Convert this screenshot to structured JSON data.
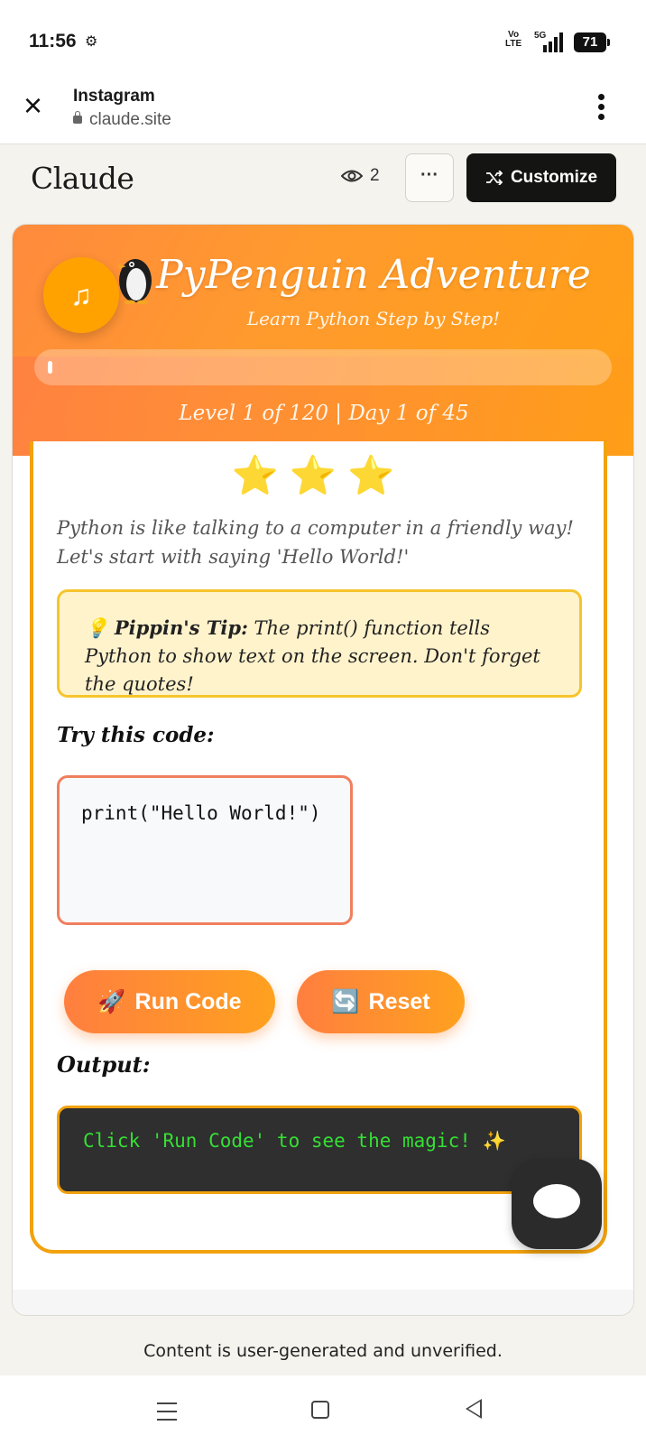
{
  "status_bar": {
    "time": "11:56",
    "network_label": "Vo LTE",
    "network_type": "5G",
    "battery": "71"
  },
  "browser": {
    "app_title": "Instagram",
    "url": "claude.site"
  },
  "claude_header": {
    "logo": "Claude",
    "view_count": "2",
    "more_label": "···",
    "customize_label": "Customize"
  },
  "hero": {
    "music_icon": "♫",
    "penguin_icon": "penguin",
    "title": "PyPenguin Adventure",
    "subtitle": "Learn Python Step by Step!",
    "progress_fraction": 0.008,
    "level_text": "Level 1 of 120 | Day 1 of 45"
  },
  "lesson": {
    "stars": "⭐⭐⭐",
    "intro": "Python is like talking to a computer in a friendly way! Let's start with saying 'Hello World!'",
    "tip_icon": "💡",
    "tip_label": "Pippin's Tip:",
    "tip_text": "The print() function tells Python to show text on the screen. Don't forget the quotes!",
    "try_label": "Try this code:",
    "code": "print(\"Hello World!\")",
    "run_label": "Run Code",
    "run_icon": "🚀",
    "reset_label": "Reset",
    "reset_icon": "🔄",
    "output_label": "Output:",
    "output_text": "Click 'Run Code' to see the magic! ✨"
  },
  "footer": {
    "note": "Content is user-generated and unverified."
  },
  "colors": {
    "accent_orange": "#ff9a2e",
    "card_border": "#f2a20e",
    "output_green": "#34e034"
  }
}
